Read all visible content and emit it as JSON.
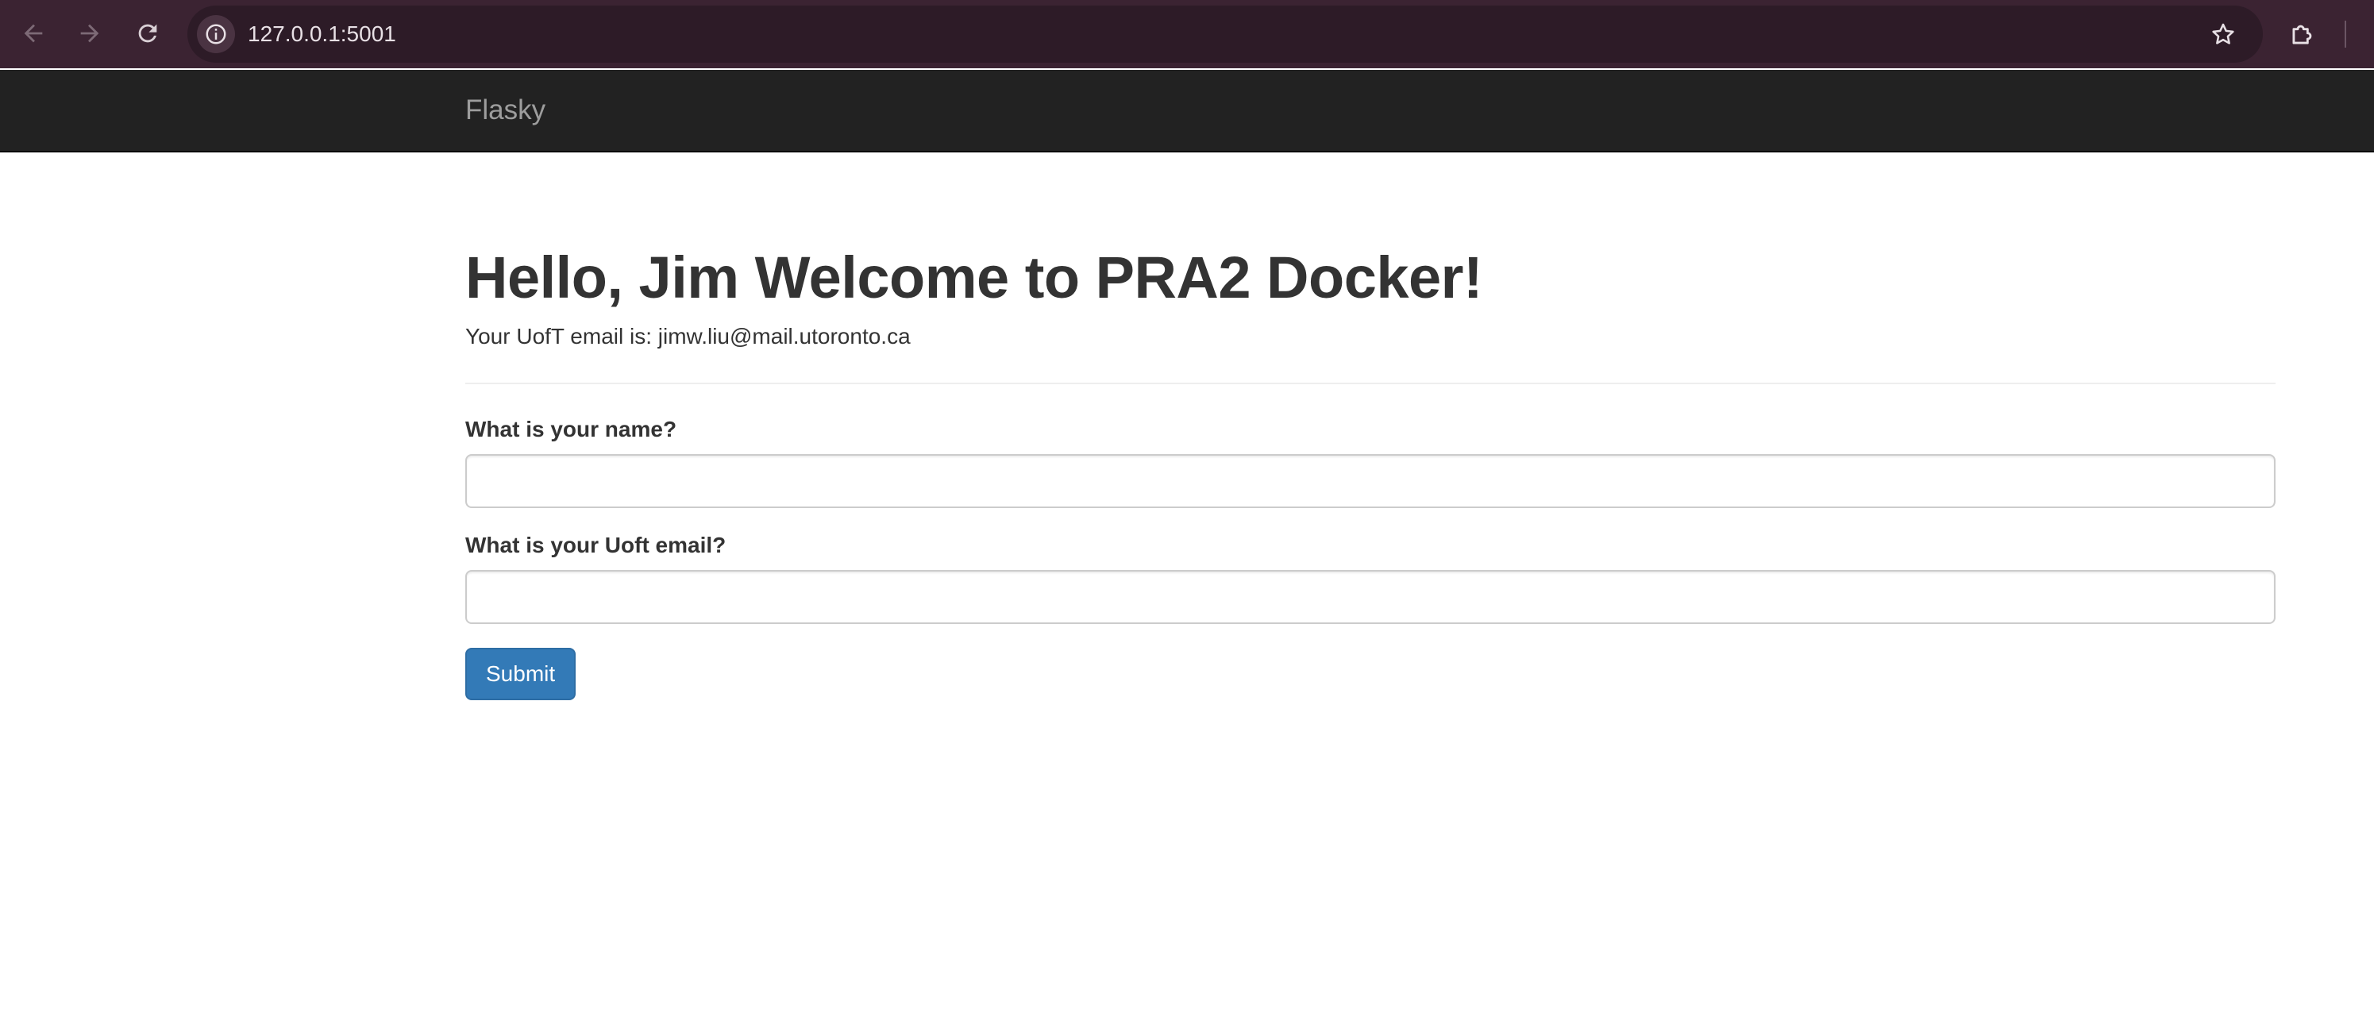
{
  "browser": {
    "url": "127.0.0.1:5001",
    "icons": {
      "back": "arrow-left-icon",
      "forward": "arrow-right-icon",
      "reload": "reload-icon",
      "site_info": "info-icon",
      "bookmark": "star-icon",
      "extensions": "puzzle-icon"
    }
  },
  "navbar": {
    "brand": "Flasky"
  },
  "page": {
    "title": "Hello, Jim Welcome to PRA2 Docker!",
    "email_line": "Your UofT email is: jimw.liu@mail.utoronto.ca"
  },
  "form": {
    "name_label": "What is your name?",
    "name_value": "",
    "email_label": "What is your Uoft email?",
    "email_value": "",
    "submit_label": "Submit"
  },
  "colors": {
    "browser_bar": "#3b2332",
    "navbar": "#222222",
    "brand_text": "#9d9d9d",
    "primary_button": "#337ab7",
    "heading_text": "#333333"
  }
}
